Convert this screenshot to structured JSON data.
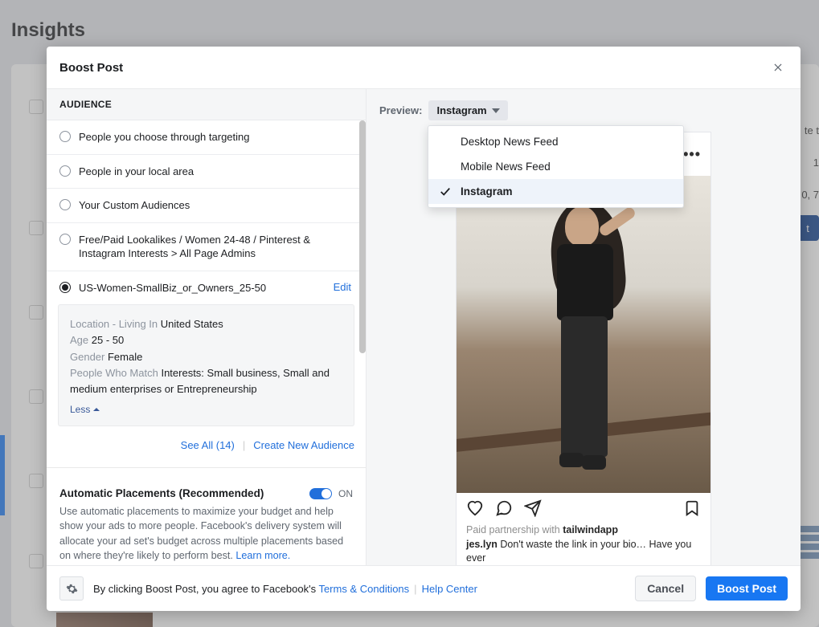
{
  "page": {
    "title": "Insights"
  },
  "modal": {
    "title": "Boost Post"
  },
  "audience": {
    "header": "AUDIENCE",
    "options": [
      "People you choose through targeting",
      "People in your local area",
      "Your Custom Audiences",
      "Free/Paid Lookalikes / Women 24-48 / Pinterest & Instagram Interests > All Page Admins",
      "US-Women-SmallBiz_or_Owners_25-50"
    ],
    "edit": "Edit",
    "summary": {
      "location_label": "Location - Living In ",
      "location_value": "United States",
      "age_label": "Age ",
      "age_value": "25 - 50",
      "gender_label": "Gender ",
      "gender_value": "Female",
      "match_label": "People Who Match ",
      "match_value": "Interests: Small business, Small and medium enterprises or Entrepreneurship",
      "less": "Less"
    },
    "see_all": "See All (14)",
    "create_new": "Create New Audience"
  },
  "placements": {
    "title": "Automatic Placements (Recommended)",
    "toggle_label": "ON",
    "desc_1": "Use automatic placements to maximize your budget and help show your ads to more people. Facebook's delivery system will allocate your ad set's budget across multiple placements based on where they're likely to perform best. ",
    "learn_more": "Learn more."
  },
  "preview": {
    "label": "Preview:",
    "selected": "Instagram",
    "options": [
      "Desktop News Feed",
      "Mobile News Feed",
      "Instagram"
    ]
  },
  "post": {
    "paid_prefix": "Paid partnership with ",
    "paid_partner": "tailwindapp",
    "caption_user": "jes.lyn",
    "caption_text": " Don't waste the link in your bio… Have you ever"
  },
  "footer": {
    "agree_prefix": "By clicking Boost Post, you agree to Facebook's ",
    "terms": "Terms & Conditions",
    "help": "Help Center",
    "cancel": "Cancel",
    "submit": "Boost Post"
  },
  "bg": {
    "right1": "te t",
    "right2": "1",
    "right3": "0, 7",
    "btn": "t"
  }
}
